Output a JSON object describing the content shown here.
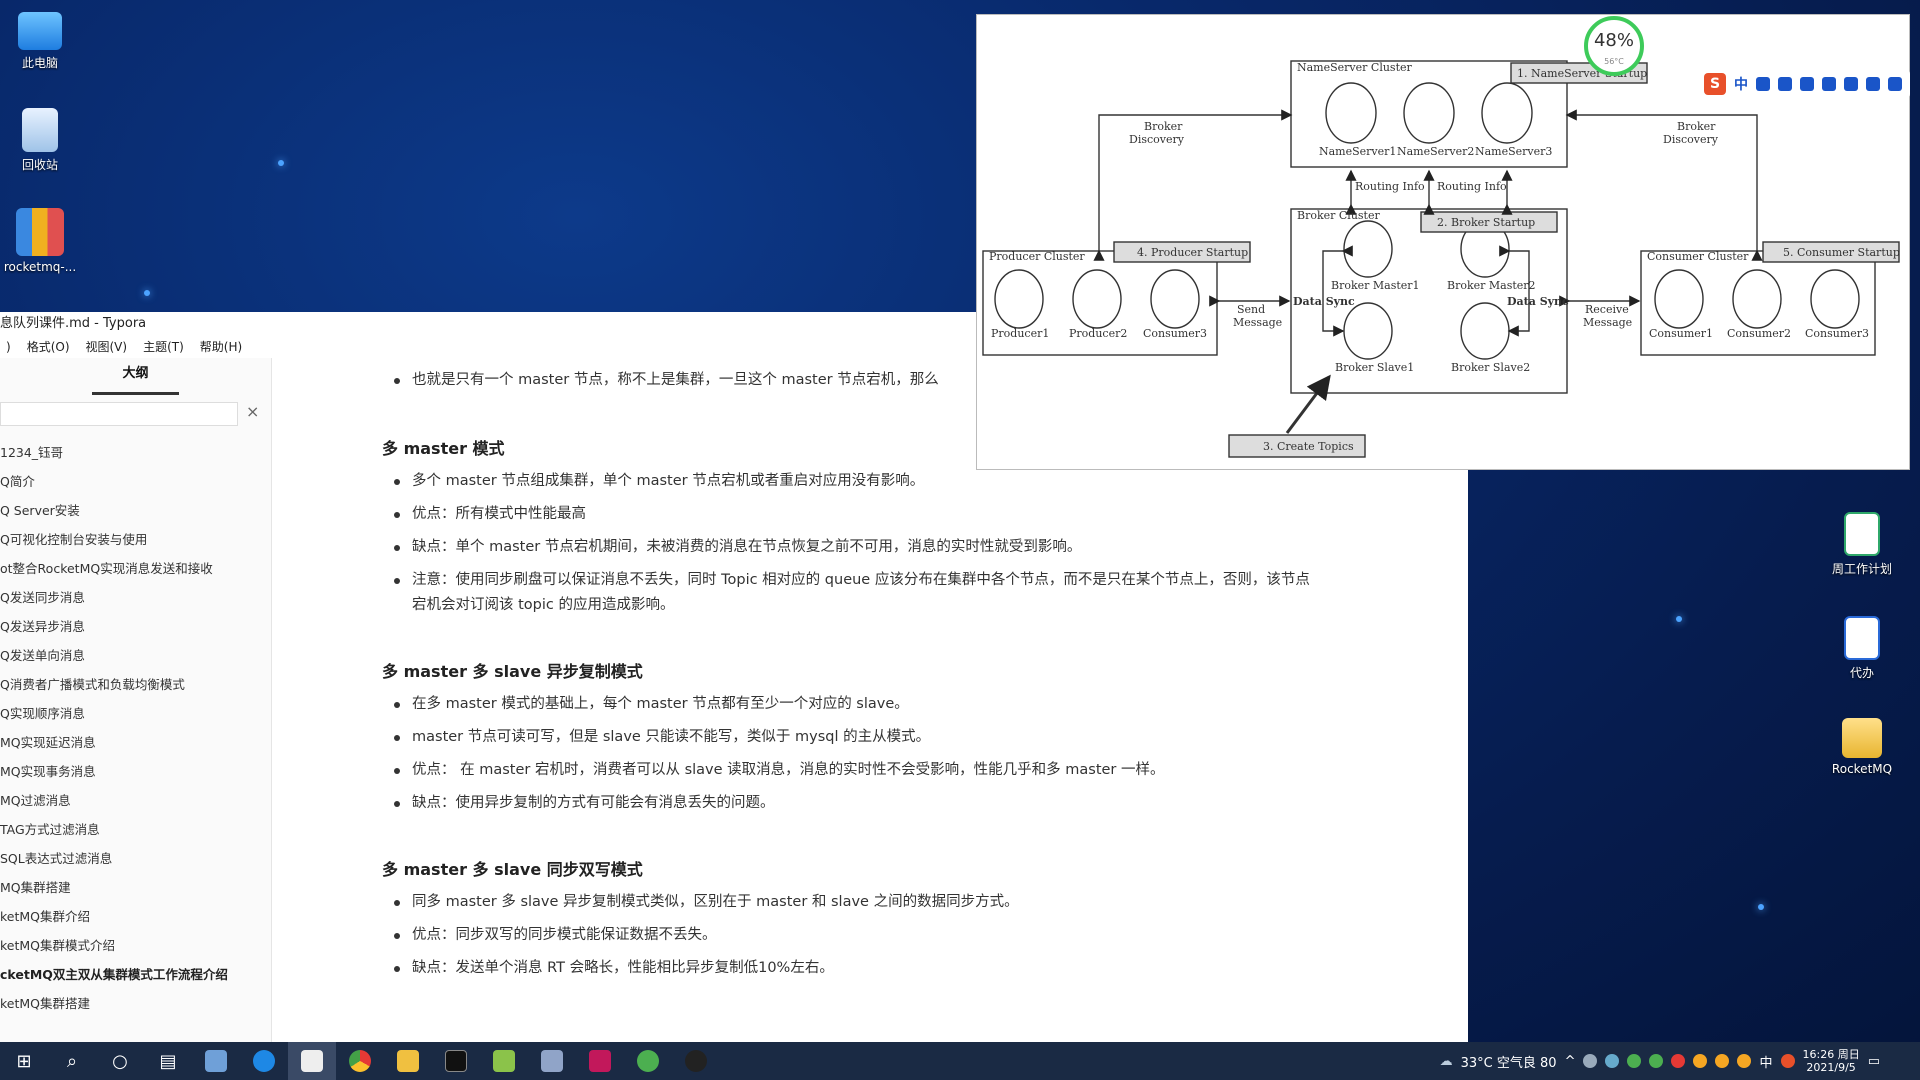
{
  "desktop": {
    "icons": [
      {
        "label": "此电脑"
      },
      {
        "label": "回收站"
      },
      {
        "label": "rocketmq-..."
      },
      {
        "label": "周工作计划"
      },
      {
        "label": "代办"
      },
      {
        "label": "RocketMQ"
      }
    ]
  },
  "window": {
    "title": "息队列课件.md - Typora",
    "menu": [
      ")",
      "格式(O)",
      "视图(V)",
      "主题(T)",
      "帮助(H)"
    ]
  },
  "sidebar": {
    "tab_label": "大纲",
    "search_value": "",
    "close_glyph": "×",
    "items": [
      "1234_钰哥",
      "Q简介",
      "Q Server安装",
      "Q可视化控制台安装与使用",
      "ot整合RocketMQ实现消息发送和接收",
      "Q发送同步消息",
      "Q发送异步消息",
      "Q发送单向消息",
      "Q消费者广播模式和负载均衡模式",
      "Q实现顺序消息",
      "MQ实现延迟消息",
      "MQ实现事务消息",
      "MQ过滤消息",
      "TAG方式过滤消息",
      "SQL表达式过滤消息",
      "MQ集群搭建",
      "ketMQ集群介绍",
      "ketMQ集群模式介绍",
      "cketMQ双主双从集群模式工作流程介绍",
      "ketMQ集群搭建"
    ],
    "active_index": 18
  },
  "content": {
    "intro_bullet": "也就是只有一个 master 节点，称不上是集群，一旦这个 master 节点宕机，那么",
    "sections": [
      {
        "heading": "多 master 模式",
        "bullets": [
          "多个 master 节点组成集群，单个 master 节点宕机或者重启对应用没有影响。",
          "优点：所有模式中性能最高",
          "缺点：单个 master 节点宕机期间，未被消费的消息在节点恢复之前不可用，消息的实时性就受到影响。",
          "注意：使用同步刷盘可以保证消息不丢失，同时 Topic 相对应的 queue 应该分布在集群中各个节点，而不是只在某个节点上，否则，该节点宕机会对订阅该 topic 的应用造成影响。"
        ]
      },
      {
        "heading": "多 master 多 slave 异步复制模式",
        "bullets": [
          "在多 master 模式的基础上，每个 master 节点都有至少一个对应的 slave。",
          "master 节点可读可写，但是 slave 只能读不能写，类似于 mysql 的主从模式。",
          "优点： 在 master 宕机时，消费者可以从 slave 读取消息，消息的实时性不会受影响，性能几乎和多 master 一样。",
          "缺点：使用异步复制的方式有可能会有消息丢失的问题。"
        ]
      },
      {
        "heading": "多 master 多 slave 同步双写模式",
        "bullets": [
          "同多 master 多 slave 异步复制模式类似，区别在于 master 和 slave 之间的数据同步方式。",
          "优点：同步双写的同步模式能保证数据不丢失。",
          "缺点：发送单个消息 RT 会略长，性能相比异步复制低10%左右。"
        ]
      }
    ]
  },
  "diagram": {
    "nameserver_cluster": "NameServer Cluster",
    "nameservers": [
      "NameServer1",
      "NameServer2",
      "NameServer3"
    ],
    "step1": "1. NameServer Startup",
    "broker_cluster": "Broker Cluster",
    "step2": "2. Broker Startup",
    "brokers": [
      "Broker Master1",
      "Broker Master2",
      "Broker Slave1",
      "Broker Slave2"
    ],
    "producer_cluster": "Producer Cluster",
    "step4": "4. Producer Startup",
    "producers": [
      "Producer1",
      "Producer2",
      "Consumer3"
    ],
    "consumer_cluster": "Consumer Cluster",
    "step5": "5. Consumer Startup",
    "consumers": [
      "Consumer1",
      "Consumer2",
      "Consumer3"
    ],
    "step3": "3. Create Topics",
    "broker_discovery": [
      "Broker",
      "Discovery"
    ],
    "routing_info": "Routing Info",
    "data_sync": "Data Sync",
    "send_message": [
      "Send",
      "Message"
    ],
    "receive_message": [
      "Receive",
      "Message"
    ]
  },
  "gauge": {
    "percent": "48%",
    "temp": "56°C",
    "value": 48,
    "color": "#3ecb5a"
  },
  "ime": {
    "label": "中"
  },
  "taskbar": {
    "weather": "33°C 空气良 80",
    "ime_tray": "中",
    "time": "16:26 周日",
    "date": "2021/9/5"
  }
}
